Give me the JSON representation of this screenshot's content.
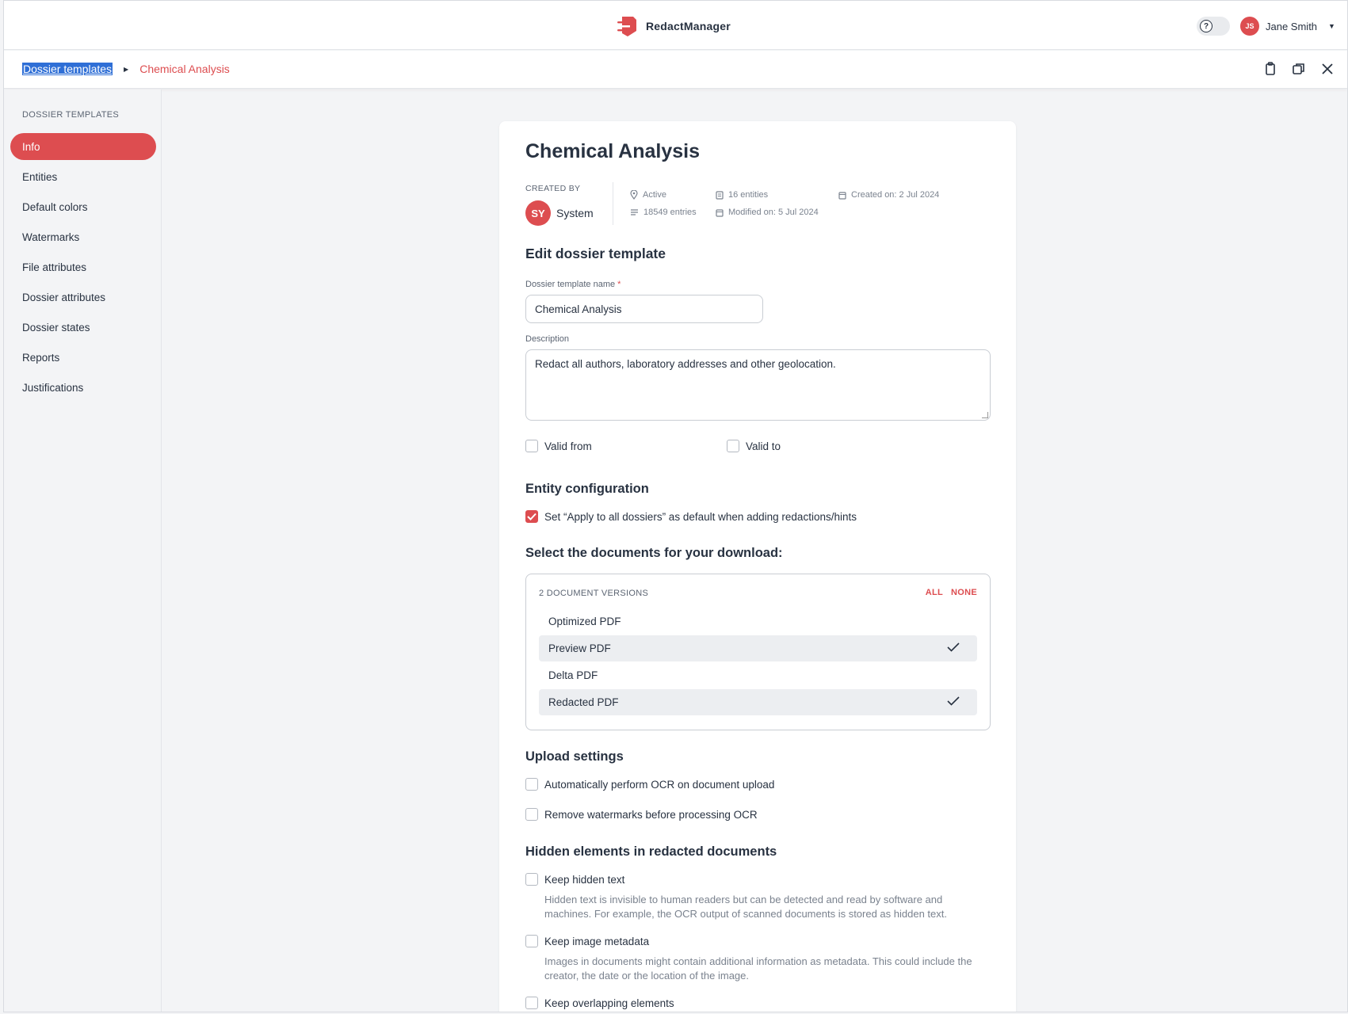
{
  "app": {
    "name": "RedactManager",
    "brand_color": "#dd4d50"
  },
  "header": {
    "user_initials": "JS",
    "user_name": "Jane Smith"
  },
  "breadcrumb": {
    "root": "Dossier templates",
    "current": "Chemical Analysis"
  },
  "toolbar": {
    "icons": [
      "clipboard-icon",
      "copy-icon",
      "close-icon"
    ]
  },
  "sidebar": {
    "title": "DOSSIER TEMPLATES",
    "items": [
      {
        "label": "Info",
        "active": true
      },
      {
        "label": "Entities"
      },
      {
        "label": "Default colors"
      },
      {
        "label": "Watermarks"
      },
      {
        "label": "File attributes"
      },
      {
        "label": "Dossier attributes"
      },
      {
        "label": "Dossier states"
      },
      {
        "label": "Reports"
      },
      {
        "label": "Justifications"
      }
    ]
  },
  "template": {
    "title": "Chemical Analysis",
    "created_by_label": "CREATED BY",
    "creator_initials": "SY",
    "creator_name": "System",
    "stats": {
      "status": "Active",
      "entries": "18549 entries",
      "entities": "16 entities",
      "modified": "Modified on: 5 Jul 2024",
      "created": "Created on: 2 Jul 2024"
    }
  },
  "form": {
    "heading": "Edit dossier template",
    "name_label": "Dossier template name",
    "name_required": "*",
    "name_value": "Chemical Analysis",
    "description_label": "Description",
    "description_value": "Redact all authors, laboratory addresses and other geolocation.",
    "valid_from": "Valid from",
    "valid_to": "Valid to"
  },
  "entity_config": {
    "heading": "Entity configuration",
    "apply_all_label": "Set “Apply to all dossiers” as default when adding redactions/hints",
    "apply_all_checked": true
  },
  "downloads": {
    "heading": "Select the documents for your download:",
    "box_title": "2 DOCUMENT VERSIONS",
    "all": "ALL",
    "none": "NONE",
    "items": [
      {
        "label": "Optimized PDF",
        "selected": false
      },
      {
        "label": "Preview PDF",
        "selected": true
      },
      {
        "label": "Delta PDF",
        "selected": false
      },
      {
        "label": "Redacted PDF",
        "selected": true
      }
    ]
  },
  "upload": {
    "heading": "Upload settings",
    "ocr": "Automatically perform OCR on document upload",
    "watermarks": "Remove watermarks before processing OCR"
  },
  "hidden": {
    "heading": "Hidden elements in redacted documents",
    "keep_text": "Keep hidden text",
    "keep_text_hint": "Hidden text is invisible to human readers but can be detected and read by software and machines. For example, the OCR output of scanned documents is stored as hidden text.",
    "keep_meta": "Keep image metadata",
    "keep_meta_hint": "Images in documents might contain additional information as metadata. This could include the creator, the date or the location of the image.",
    "keep_overlap": "Keep overlapping elements"
  }
}
